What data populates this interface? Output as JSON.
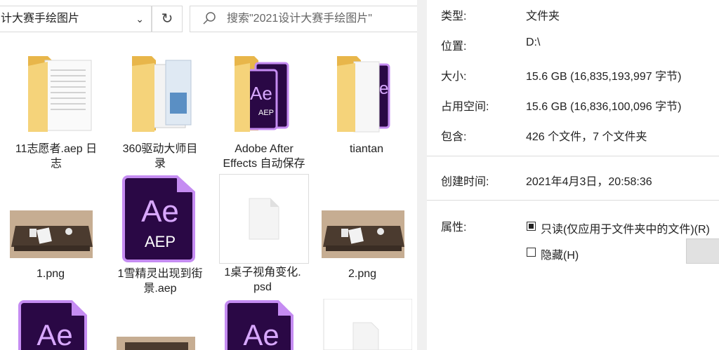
{
  "explorer": {
    "address": "计大赛手绘图片",
    "search_placeholder": "搜索\"2021设计大赛手绘图片\"",
    "items": [
      {
        "label_line1": "11志愿者.aep 日",
        "label_line2": "志",
        "type": "folder-doc"
      },
      {
        "label_line1": "360驱动大师目",
        "label_line2": "录",
        "type": "folder-doc"
      },
      {
        "label_line1": "Adobe After",
        "label_line2": "Effects 自动保存",
        "type": "folder-ae"
      },
      {
        "label_line1": "tiantan",
        "label_line2": "",
        "type": "folder-ae"
      },
      {
        "label_line1": "1.png",
        "label_line2": "",
        "type": "png"
      },
      {
        "label_line1": "1雪精灵出现到街",
        "label_line2": "景.aep",
        "type": "aep"
      },
      {
        "label_line1": "1桌子视角变化.",
        "label_line2": "psd",
        "type": "psd"
      },
      {
        "label_line1": "2.png",
        "label_line2": "",
        "type": "png"
      }
    ],
    "ae_text": "Ae",
    "aep_text": "AEP",
    "ae_folder_small": "AEP"
  },
  "properties": {
    "type_label": "类型:",
    "type_value": "文件夹",
    "location_label": "位置:",
    "location_value": "D:\\",
    "size_label": "大小:",
    "size_value": "15.6 GB (16,835,193,997 字节)",
    "disk_label": "占用空间:",
    "disk_value": "15.6 GB (16,836,100,096 字节)",
    "contains_label": "包含:",
    "contains_value": "426 个文件，7 个文件夹",
    "created_label": "创建时间:",
    "created_value": "2021年4月3日，20:58:36",
    "attributes_label": "属性:",
    "readonly_label": "只读(仅应用于文件夹中的文件)(R)",
    "hidden_label": "隐藏(H)"
  },
  "colors": {
    "folder": "#f5d37a",
    "folder_dark": "#e8b64a",
    "ae_dark": "#2a0845",
    "ae_accent": "#c58cf2",
    "png_bg": "#c6ad92"
  }
}
